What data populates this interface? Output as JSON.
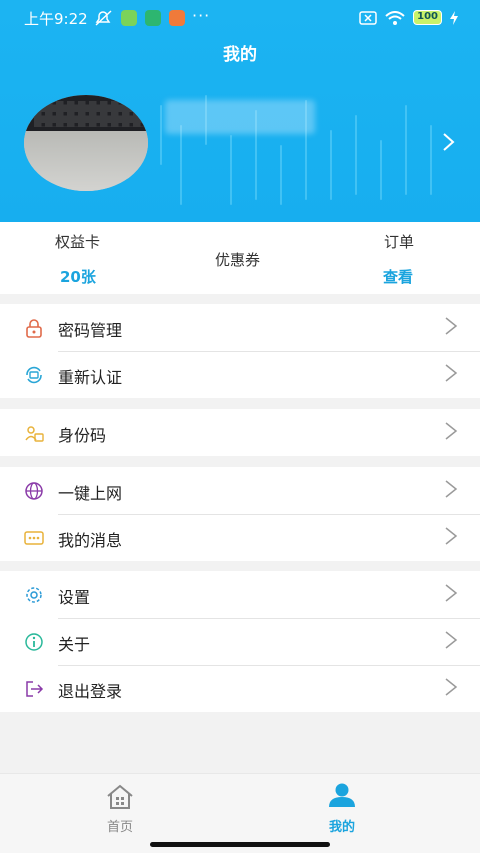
{
  "status_bar": {
    "time": "上午9:22",
    "dots": "···",
    "battery": "100"
  },
  "header": {
    "title": "我的"
  },
  "stats": {
    "card_label": "权益卡",
    "card_value": "20张",
    "coupon_label": "优惠券",
    "order_label": "订单",
    "order_value": "查看"
  },
  "menu": {
    "groups": [
      {
        "items": [
          {
            "label": "密码管理",
            "icon": "lock-icon",
            "color": "#e06a4a"
          },
          {
            "label": "重新认证",
            "icon": "refresh-id-icon",
            "color": "#2aa6d6"
          }
        ]
      },
      {
        "items": [
          {
            "label": "身份码",
            "icon": "id-card-icon",
            "color": "#e8b23a"
          }
        ]
      },
      {
        "items": [
          {
            "label": "一键上网",
            "icon": "globe-icon",
            "color": "#8a3aa8"
          },
          {
            "label": "我的消息",
            "icon": "message-icon",
            "color": "#e8b23a"
          }
        ]
      },
      {
        "items": [
          {
            "label": "设置",
            "icon": "gear-icon",
            "color": "#2a9ad6"
          },
          {
            "label": "关于",
            "icon": "info-icon",
            "color": "#2ab89a"
          },
          {
            "label": "退出登录",
            "icon": "logout-icon",
            "color": "#8a3aa8"
          }
        ]
      }
    ]
  },
  "tabbar": {
    "home_label": "首页",
    "mine_label": "我的",
    "active_color": "#1ba4de",
    "inactive_color": "#888888"
  }
}
